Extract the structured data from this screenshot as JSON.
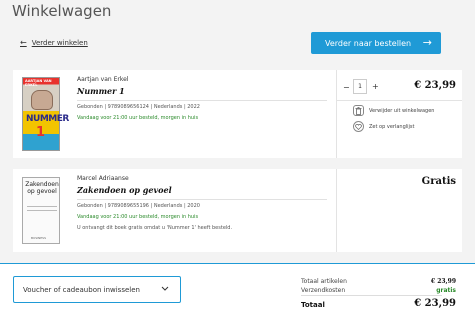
{
  "page": {
    "title": "Winkelwagen"
  },
  "nav": {
    "back_label": "Verder winkelen",
    "checkout_label": "Verder naar bestellen"
  },
  "colors": {
    "accent": "#1f9ad6",
    "delivery_green": "#2a8a2a"
  },
  "items": [
    {
      "author": "Aartjan van Erkel",
      "title": "Nummer 1",
      "meta": "Gebonden | 9789089656124 | Nederlands | 2022",
      "delivery": "Vandaag voor 21:00 uur besteld, morgen in huis",
      "quantity": "1",
      "price": "€ 23,99",
      "remove_label": "Verwijder uit winkelwagen",
      "wishlist_label": "Zet op verlanglijst",
      "cover": {
        "band_text": "AARTJAN VAN ERKEL",
        "big_text": "NUMMER",
        "number": "1"
      }
    },
    {
      "author": "Marcel Adriaanse",
      "title": "Zakendoen op gevoel",
      "meta": "Gebonden | 9789089655196 | Nederlands | 2020",
      "delivery": "Vandaag voor 21:00 uur besteld, morgen in huis",
      "note": "U ontvangt dit boek gratis omdat u 'Nummer 1' heeft besteld.",
      "price": "Gratis",
      "cover": {
        "title_text": "Zakendoen op gevoel",
        "publisher": "BUSINESS"
      }
    }
  ],
  "voucher": {
    "label": "Voucher of cadeaubon inwisselen"
  },
  "summary": {
    "articles_label": "Totaal artikelen",
    "articles_value": "€ 23,99",
    "shipping_label": "Verzendkosten",
    "shipping_value": "gratis",
    "total_label": "Totaal",
    "total_value": "€ 23,99"
  }
}
